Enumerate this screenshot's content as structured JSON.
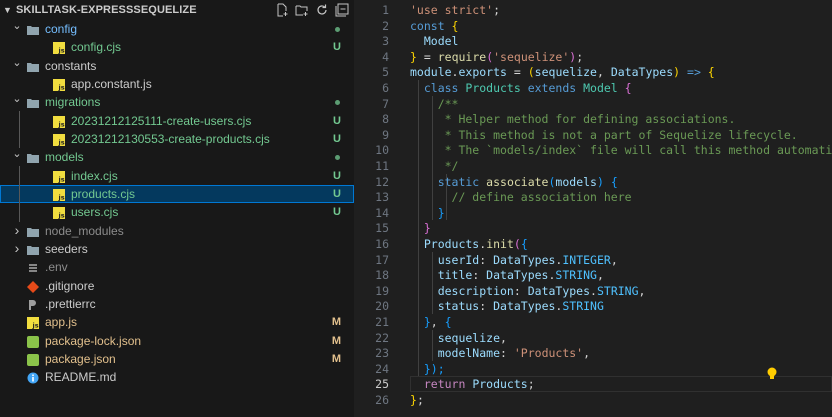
{
  "explorer": {
    "title": "SKILLTASK-EXPRESSSEQUELIZE",
    "items": [
      {
        "label": "config",
        "kind": "folder",
        "open": true,
        "color": "#75beff",
        "status": "dot"
      },
      {
        "label": "config.cjs",
        "kind": "js",
        "color": "#73c991",
        "badge": "U"
      },
      {
        "label": "constants",
        "kind": "folder",
        "open": true,
        "color": "#cccccc"
      },
      {
        "label": "app.constant.js",
        "kind": "js",
        "color": "#cccccc"
      },
      {
        "label": "migrations",
        "kind": "folder",
        "open": true,
        "color": "#73c991",
        "status": "dot"
      },
      {
        "label": "20231212125111-create-users.cjs",
        "kind": "js",
        "color": "#73c991",
        "badge": "U"
      },
      {
        "label": "20231212130553-create-products.cjs",
        "kind": "js",
        "color": "#73c991",
        "badge": "U"
      },
      {
        "label": "models",
        "kind": "folder",
        "open": true,
        "color": "#73c991",
        "status": "dot"
      },
      {
        "label": "index.cjs",
        "kind": "js",
        "color": "#73c991",
        "badge": "U"
      },
      {
        "label": "products.cjs",
        "kind": "js",
        "color": "#73c991",
        "badge": "U",
        "selected": true
      },
      {
        "label": "users.cjs",
        "kind": "js",
        "color": "#73c991",
        "badge": "U"
      },
      {
        "label": "node_modules",
        "kind": "folder",
        "open": false,
        "color": "#8c8c8c"
      },
      {
        "label": "seeders",
        "kind": "folder",
        "open": false,
        "color": "#cccccc"
      },
      {
        "label": ".env",
        "kind": "env",
        "color": "#8c8c8c"
      },
      {
        "label": ".gitignore",
        "kind": "git",
        "color": "#cccccc"
      },
      {
        "label": ".prettierrc",
        "kind": "prettier",
        "color": "#cccccc"
      },
      {
        "label": "app.js",
        "kind": "js",
        "color": "#e2c08d",
        "badge": "M"
      },
      {
        "label": "package-lock.json",
        "kind": "json",
        "color": "#e2c08d",
        "badge": "M"
      },
      {
        "label": "package.json",
        "kind": "json",
        "color": "#e2c08d",
        "badge": "M"
      },
      {
        "label": "README.md",
        "kind": "info",
        "color": "#cccccc"
      }
    ]
  },
  "editor": {
    "active_line": 25,
    "lines": [
      [
        [
          "'use strict'",
          "s"
        ],
        [
          ";",
          "p"
        ]
      ],
      [
        [
          "const ",
          "k"
        ],
        [
          "{",
          "b1"
        ]
      ],
      [
        [
          "  Model",
          "v"
        ]
      ],
      [
        [
          "} ",
          "b1"
        ],
        [
          "= ",
          "p"
        ],
        [
          "require",
          "f"
        ],
        [
          "(",
          "b2"
        ],
        [
          "'sequelize'",
          "s"
        ],
        [
          ")",
          "b2"
        ],
        [
          ";",
          "p"
        ]
      ],
      [
        [
          "module",
          "v"
        ],
        [
          ".",
          "p"
        ],
        [
          "exports",
          "v"
        ],
        [
          " = ",
          "p"
        ],
        [
          "(",
          "b1"
        ],
        [
          "sequelize",
          "v"
        ],
        [
          ", ",
          "p"
        ],
        [
          "DataTypes",
          "v"
        ],
        [
          ")",
          "b1"
        ],
        [
          " => ",
          "k"
        ],
        [
          "{",
          "b1"
        ]
      ],
      [
        [
          "  class ",
          "k"
        ],
        [
          "Products ",
          "t"
        ],
        [
          "extends ",
          "k"
        ],
        [
          "Model ",
          "t"
        ],
        [
          "{",
          "b2"
        ]
      ],
      [
        [
          "    /**",
          "cm"
        ]
      ],
      [
        [
          "     * Helper method for defining associations.",
          "cm"
        ]
      ],
      [
        [
          "     * This method is not a part of Sequelize lifecycle.",
          "cm"
        ]
      ],
      [
        [
          "     * The `models/index` file will call this method automatically.",
          "cm"
        ]
      ],
      [
        [
          "     */",
          "cm"
        ]
      ],
      [
        [
          "    static ",
          "k"
        ],
        [
          "associate",
          "f"
        ],
        [
          "(",
          "b3"
        ],
        [
          "models",
          "v"
        ],
        [
          ") ",
          "b3"
        ],
        [
          "{",
          "b3"
        ]
      ],
      [
        [
          "      // define association here",
          "cm"
        ]
      ],
      [
        [
          "    }",
          "b3"
        ]
      ],
      [
        [
          "  }",
          "b2"
        ]
      ],
      [
        [
          "  Products",
          "v"
        ],
        [
          ".",
          "p"
        ],
        [
          "init",
          "f"
        ],
        [
          "(",
          "b2"
        ],
        [
          "{",
          "b3"
        ]
      ],
      [
        [
          "    userId",
          "v"
        ],
        [
          ": ",
          "p"
        ],
        [
          "DataTypes",
          "v"
        ],
        [
          ".",
          "p"
        ],
        [
          "INTEGER",
          "num"
        ],
        [
          ",",
          "p"
        ]
      ],
      [
        [
          "    title",
          "v"
        ],
        [
          ": ",
          "p"
        ],
        [
          "DataTypes",
          "v"
        ],
        [
          ".",
          "p"
        ],
        [
          "STRING",
          "num"
        ],
        [
          ",",
          "p"
        ]
      ],
      [
        [
          "    description",
          "v"
        ],
        [
          ": ",
          "p"
        ],
        [
          "DataTypes",
          "v"
        ],
        [
          ".",
          "p"
        ],
        [
          "STRING",
          "num"
        ],
        [
          ",",
          "p"
        ]
      ],
      [
        [
          "    status",
          "v"
        ],
        [
          ": ",
          "p"
        ],
        [
          "DataTypes",
          "v"
        ],
        [
          ".",
          "p"
        ],
        [
          "STRING",
          "num"
        ]
      ],
      [
        [
          "  }",
          "b3"
        ],
        [
          ", ",
          "p"
        ],
        [
          "{",
          "b3"
        ]
      ],
      [
        [
          "    sequelize",
          "v"
        ],
        [
          ",",
          "p"
        ]
      ],
      [
        [
          "    modelName",
          "v"
        ],
        [
          ": ",
          "p"
        ],
        [
          "'Products'",
          "s"
        ],
        [
          ",",
          "p"
        ]
      ],
      [
        [
          "  });",
          "b3"
        ]
      ],
      [
        [
          "  return ",
          "c"
        ],
        [
          "Products",
          "v"
        ],
        [
          ";",
          "p"
        ]
      ],
      [
        [
          "}",
          "b1"
        ],
        [
          ";",
          "p"
        ]
      ]
    ]
  }
}
